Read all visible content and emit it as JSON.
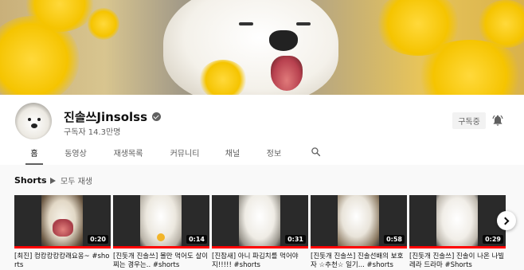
{
  "channel": {
    "name": "진솔쓰Jinsolss",
    "subscribers": "구독자 14.3만명",
    "subscribe_state": "구독중"
  },
  "tabs": [
    {
      "label": "홈",
      "active": true
    },
    {
      "label": "동영상",
      "active": false
    },
    {
      "label": "재생목록",
      "active": false
    },
    {
      "label": "커뮤니티",
      "active": false
    },
    {
      "label": "채널",
      "active": false
    },
    {
      "label": "정보",
      "active": false
    }
  ],
  "icons": {
    "verified": "verified-check-icon",
    "bell": "bell-icon",
    "search": "search-icon",
    "play": "play-icon",
    "next": "chevron-right-icon"
  },
  "shelf": {
    "title": "Shorts",
    "play_all": "모두 재생",
    "videos": [
      {
        "duration": "0:20",
        "title": "[최진] 컹캉캉캉캉래요옹~ #shorts"
      },
      {
        "duration": "0:14",
        "title": "[진돗개 진솔쓰] 몰만 먹어도 살이 찌는 경우는.. #shorts"
      },
      {
        "duration": "0:31",
        "title": "[진참새] 아니 파김치를 먹어야지!!!!! #shorts"
      },
      {
        "duration": "0:58",
        "title": "[진돗개 진솔쓰] 진솔선배의 보호자 ☆추천☆ 일기... #shorts"
      },
      {
        "duration": "0:29",
        "title": "[진돗개 진솔쓰] 진솔이 나온 나빌레라 드라마 #Shorts"
      }
    ]
  },
  "colors": {
    "accent_red": "#ff0000",
    "text_primary": "#0f0f0f",
    "text_secondary": "#606060"
  }
}
